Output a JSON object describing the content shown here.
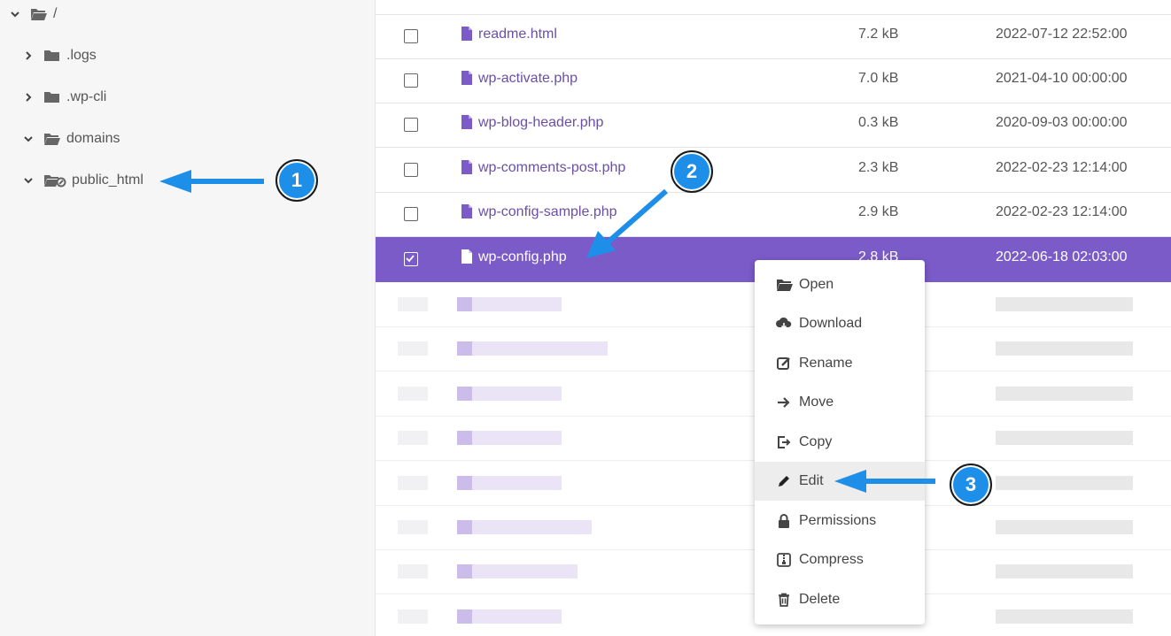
{
  "sidebar": {
    "items": [
      {
        "label": "/",
        "expanded": true,
        "icon": "folder-open-icon"
      },
      {
        "label": ".logs",
        "expanded": false,
        "icon": "folder-icon"
      },
      {
        "label": ".wp-cli",
        "expanded": false,
        "icon": "folder-icon"
      },
      {
        "label": "domains",
        "expanded": true,
        "icon": "folder-open-icon"
      },
      {
        "label": "public_html",
        "expanded": true,
        "icon": "folder-link-icon"
      }
    ]
  },
  "files": [
    {
      "name": "readme.html",
      "size": "7.2 kB",
      "date": "2022-07-12 22:52:00",
      "checked": false
    },
    {
      "name": "wp-activate.php",
      "size": "7.0 kB",
      "date": "2021-04-10 00:00:00",
      "checked": false
    },
    {
      "name": "wp-blog-header.php",
      "size": "0.3 kB",
      "date": "2020-09-03 00:00:00",
      "checked": false
    },
    {
      "name": "wp-comments-post.php",
      "size": "2.3 kB",
      "date": "2022-02-23 12:14:00",
      "checked": false
    },
    {
      "name": "wp-config-sample.php",
      "size": "2.9 kB",
      "date": "2022-02-23 12:14:00",
      "checked": false
    },
    {
      "name": "wp-config.php",
      "size": "2.8 kB",
      "date": "2022-06-18 02:03:00",
      "checked": true
    }
  ],
  "context_menu": {
    "items": [
      {
        "label": "Open",
        "icon": "folder-open-icon"
      },
      {
        "label": "Download",
        "icon": "cloud-download-icon"
      },
      {
        "label": "Rename",
        "icon": "rename-icon"
      },
      {
        "label": "Move",
        "icon": "arrow-right-icon"
      },
      {
        "label": "Copy",
        "icon": "copy-icon"
      },
      {
        "label": "Edit",
        "icon": "pencil-icon",
        "highlighted": true
      },
      {
        "label": "Permissions",
        "icon": "lock-icon"
      },
      {
        "label": "Compress",
        "icon": "archive-icon"
      },
      {
        "label": "Delete",
        "icon": "trash-icon"
      }
    ]
  },
  "annotations": {
    "step1": "1",
    "step2": "2",
    "step3": "3"
  },
  "colors": {
    "accent": "#7b5bc8",
    "file_link": "#6a4fa8",
    "annotation_blue": "#1e8fe8"
  }
}
